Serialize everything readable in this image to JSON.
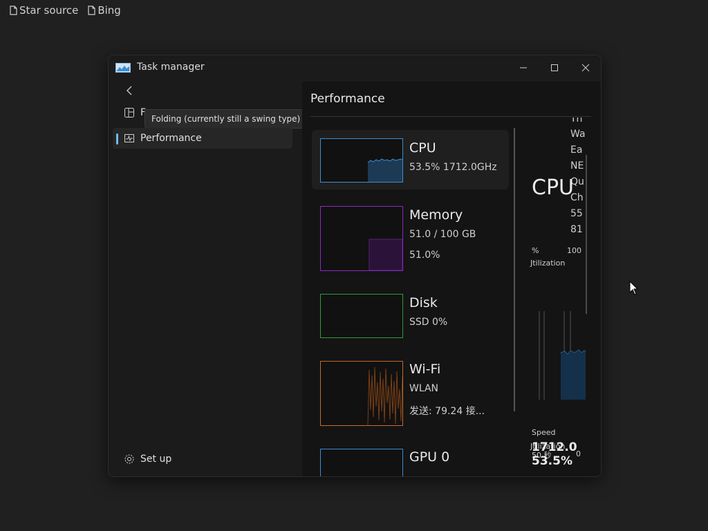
{
  "topbar": {
    "items": [
      {
        "label": "Star source",
        "icon": "document-icon"
      },
      {
        "label": "Bing",
        "icon": "document-icon"
      }
    ]
  },
  "window": {
    "title": "Task manager",
    "controls": {
      "minimize": "minimize-icon",
      "maximize": "maximize-icon",
      "close": "close-icon"
    }
  },
  "nav": {
    "back": "back-arrow-icon",
    "fold_label": "F",
    "tooltip": "Folding (currently still a swing type)",
    "performance_label": "Performance",
    "setup_label": "Set up"
  },
  "content": {
    "title": "Performance",
    "cards": [
      {
        "name": "CPU",
        "sub1": "53.5% 1712.0GHz",
        "sub2": "",
        "color": "#3b8ed4"
      },
      {
        "name": "Memory",
        "sub1": "51.0 / 100 GB",
        "sub2": "51.0%",
        "color": "#8a2bc2"
      },
      {
        "name": "Disk",
        "sub1": "SSD 0%",
        "sub2": "",
        "color": "#2e9e3a"
      },
      {
        "name": "Wi-Fi",
        "sub1": "WLAN",
        "sub2": "发送: 79.24 接...",
        "color": "#c46a2a"
      },
      {
        "name": "GPU 0",
        "sub1": "",
        "sub2": "",
        "color": "#3b8ed4"
      }
    ]
  },
  "detail": {
    "big_title": "CPU",
    "info_lines": [
      "Th",
      "Wa",
      "Ea",
      "NE",
      "Qu",
      "Ch",
      "55",
      "81"
    ],
    "pct_label": "%",
    "max_label": "100",
    "utilization_label_top": "Jtilization",
    "axis_left": "50 秒",
    "axis_right": "0",
    "utilization_label": "Jtilization",
    "utilization_value": "53.5%",
    "speed_label": "Speed",
    "speed_value": "1712.0"
  }
}
